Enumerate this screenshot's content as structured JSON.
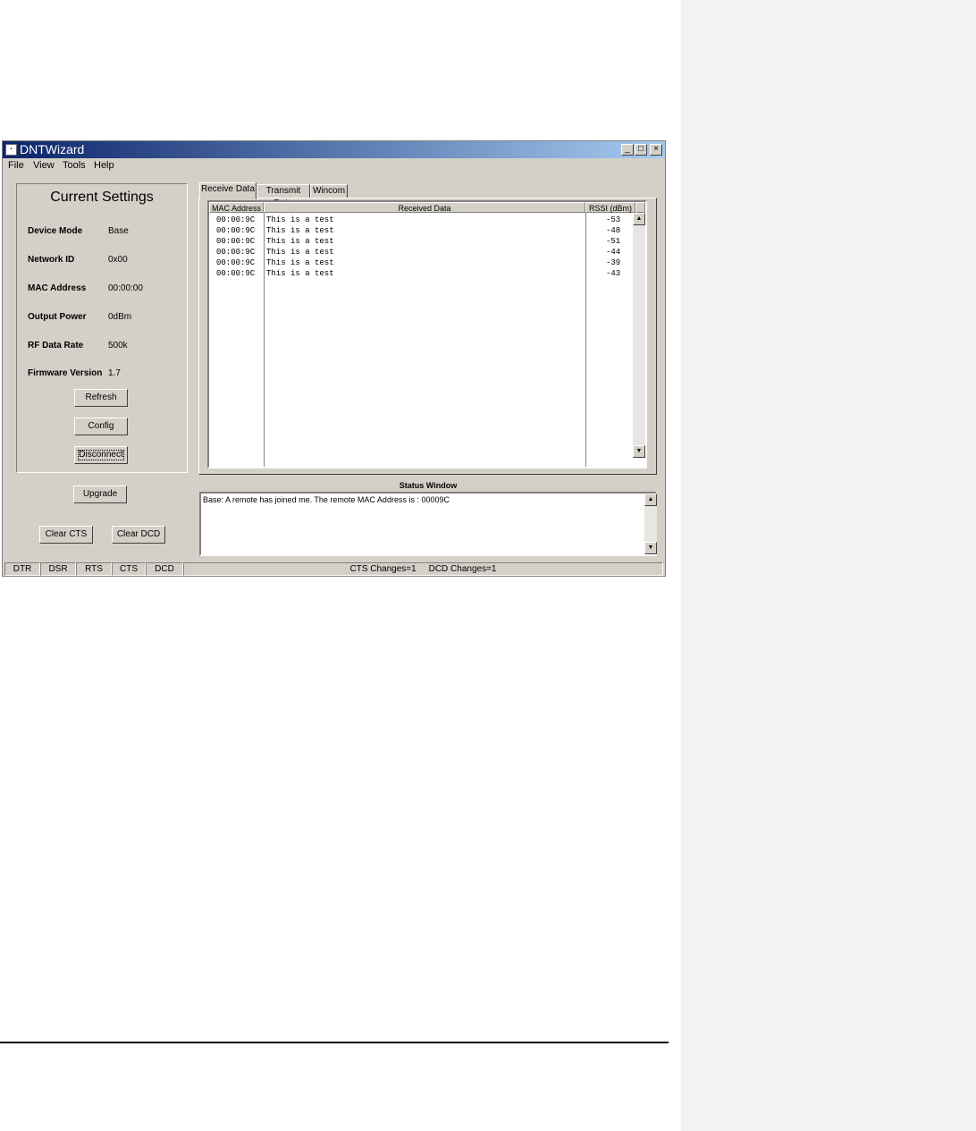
{
  "window": {
    "title": "DNTWizard",
    "controls": {
      "minimize": "_",
      "maximize": "□",
      "close": "×"
    }
  },
  "menu": [
    "File",
    "View",
    "Tools",
    "Help"
  ],
  "settings": {
    "title": "Current Settings",
    "fields": [
      {
        "label": "Device Mode",
        "value": "Base"
      },
      {
        "label": "Network ID",
        "value": "0x00"
      },
      {
        "label": "MAC Address",
        "value": "00:00:00"
      },
      {
        "label": "Output Power",
        "value": "0dBm"
      },
      {
        "label": "RF Data Rate",
        "value": "500k"
      },
      {
        "label": "Firmware Version",
        "value": "1.7"
      }
    ],
    "buttons": {
      "refresh": "Refresh",
      "config": "Config",
      "disconnect": "Disconnect"
    }
  },
  "buttons": {
    "upgrade": "Upgrade",
    "clear_cts": "Clear CTS",
    "clear_dcd": "Clear DCD"
  },
  "tabs": [
    "Receive Data",
    "Transmit Data",
    "Wincom"
  ],
  "receive_table": {
    "columns": [
      "MAC Address",
      "Received Data",
      "RSSI (dBm)"
    ],
    "rows": [
      {
        "mac": "00:00:9C",
        "data": "This is a test",
        "rssi": "-53"
      },
      {
        "mac": "00:00:9C",
        "data": "This is a test",
        "rssi": "-48"
      },
      {
        "mac": "00:00:9C",
        "data": "This is a test",
        "rssi": "-51"
      },
      {
        "mac": "00:00:9C",
        "data": "This is a test",
        "rssi": "-44"
      },
      {
        "mac": "00:00:9C",
        "data": "This is a test",
        "rssi": "-39"
      },
      {
        "mac": "00:00:9C",
        "data": "This is a test",
        "rssi": "-43"
      }
    ]
  },
  "status_window": {
    "label": "Status Window",
    "message": "Base: A remote has joined me.  The remote MAC Address is : 00009C"
  },
  "statusbar": {
    "indicators": [
      "DTR",
      "DSR",
      "RTS",
      "CTS",
      "DCD"
    ],
    "message": "CTS Changes=1     DCD Changes=1"
  }
}
